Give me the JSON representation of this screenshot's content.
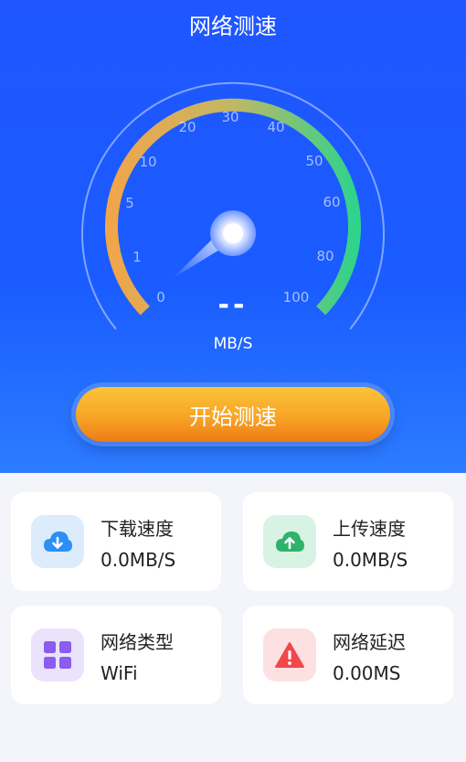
{
  "header": {
    "title": "网络测速"
  },
  "gauge": {
    "ticks": [
      "0",
      "1",
      "5",
      "10",
      "20",
      "30",
      "40",
      "50",
      "60",
      "80",
      "100"
    ],
    "speed_text": "--",
    "unit": "MB/S",
    "arc_colors": [
      "#f1a54a",
      "#c2b765",
      "#2fd38c"
    ]
  },
  "start_button": {
    "label": "开始测速",
    "color": "#f7a526"
  },
  "stats": [
    {
      "label": "下载速度",
      "value": "0.0MB/S",
      "icon": "cloud-download-icon",
      "icon_color": "#2d8ff5",
      "bg": "#dcecfb"
    },
    {
      "label": "上传速度",
      "value": "0.0MB/S",
      "icon": "cloud-upload-icon",
      "icon_color": "#2fb36b",
      "bg": "#d8f3e4"
    },
    {
      "label": "网络类型",
      "value": "WiFi",
      "icon": "grid-icon",
      "icon_color": "#8a5cf0",
      "bg": "#ebe2fb"
    },
    {
      "label": "网络延迟",
      "value": "0.00MS",
      "icon": "warning-icon",
      "icon_color": "#f0484b",
      "bg": "#fde1e2"
    }
  ]
}
